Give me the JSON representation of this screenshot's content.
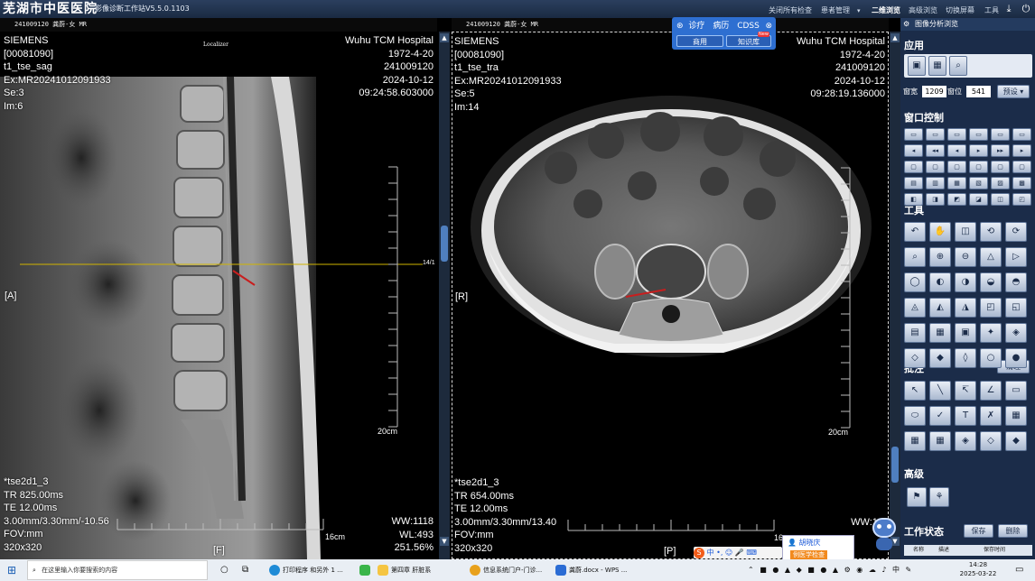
{
  "app": {
    "title": "芜湖市中医医院",
    "subtitle": "影像诊断工作站V5.5.0.1103"
  },
  "top_menu": {
    "close_all": "关闭所有检查",
    "patient_mgmt": "患者管理",
    "browse_2d": "二维浏览",
    "browse_hi": "高级浏览",
    "switch_screen": "切换屏幕",
    "tools": "工具"
  },
  "viewports": [
    {
      "header": "241009120 龚蔚-女 MR",
      "tl": [
        "SIEMENS",
        "[00081090]",
        "t1_tse_sag",
        "Ex:MR20241012091933",
        "Se:3",
        "Im:6"
      ],
      "tr": [
        "Wuhu TCM Hospital",
        "1972-4-20",
        "241009120",
        "2024-10-12",
        "09:24:58.603000"
      ],
      "bl": [
        "*tse2d1_3",
        "TR 825.00ms",
        "TE 12.00ms",
        "3.00mm/3.30mm/-10.56",
        "FOV:mm",
        "320x320"
      ],
      "br": [
        "WW:1118",
        "WL:493",
        "251.56%"
      ],
      "center_label": "Localizer",
      "left_orient": "[A]",
      "bottom_orient": "[F]",
      "scale_label": "20cm",
      "hscale_label": "16cm",
      "line_label": "14/1"
    },
    {
      "header": "241009120 龚蔚-女 MR",
      "tl": [
        "SIEMENS",
        "[00081090]",
        "t1_tse_tra",
        "Ex:MR20241012091933",
        "Se:5",
        "Im:14"
      ],
      "tr": [
        "Wuhu TCM Hospital",
        "1972-4-20",
        "241009120",
        "2024-10-12",
        "09:28:19.136000"
      ],
      "bl": [
        "*tse2d1_3",
        "TR 654.00ms",
        "TE 12.00ms",
        "3.00mm/3.30mm/13.40",
        "FOV:mm",
        "320x320"
      ],
      "br": [
        "WW:12"
      ],
      "left_orient": "[R]",
      "bottom_orient": "[P]",
      "scale_label": "20cm",
      "hscale_label": "16"
    }
  ],
  "cdss": {
    "diagnose": "诊疗",
    "record": "病历",
    "cdss": "CDSS",
    "common": "商用",
    "knowledge": "知识库",
    "badge": "New"
  },
  "right_panel": {
    "header": "图像分析浏览",
    "section_app": "应用",
    "width_label": "窗宽",
    "width_value": "1209",
    "level_label": "窗位",
    "level_value": "541",
    "preset": "预设",
    "section_window": "窗口控制",
    "section_tools": "工具",
    "section_annot": "批注",
    "clear": "清理",
    "section_adv": "高级",
    "section_status": "工作状态",
    "save": "保存",
    "delete": "删除",
    "col_name": "名称",
    "col_desc": "描述",
    "col_save_time": "保存时间"
  },
  "user_popup": {
    "name": "胡晓庆",
    "exam": "例医学检查"
  },
  "taskbar": {
    "search_placeholder": "在这里输入你要搜索的内容",
    "items": [
      "打印程序 和另外 1 ...",
      "第四章 肝脏系",
      "信息系统门户-门诊...",
      "龚蔚.docx - WPS ..."
    ],
    "time": "14:28",
    "date": "2025-03-22",
    "ime": "中"
  }
}
